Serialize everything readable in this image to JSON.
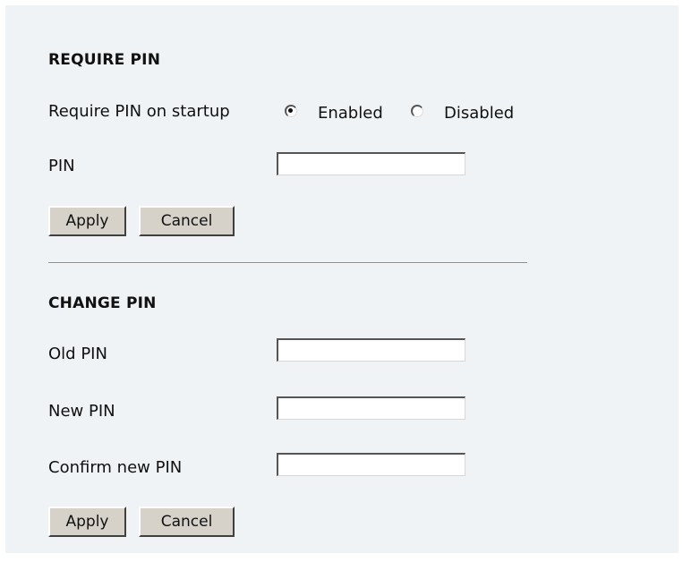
{
  "require_pin": {
    "heading": "REQUIRE PIN",
    "startup_label": "Require PIN on startup",
    "options": [
      {
        "label": "Enabled",
        "selected": true
      },
      {
        "label": "Disabled",
        "selected": false
      }
    ],
    "pin_label": "PIN",
    "pin_value": "",
    "apply_label": "Apply",
    "cancel_label": "Cancel"
  },
  "change_pin": {
    "heading": "CHANGE PIN",
    "old_pin_label": "Old PIN",
    "old_pin_value": "",
    "new_pin_label": "New PIN",
    "new_pin_value": "",
    "confirm_pin_label": "Confirm new PIN",
    "confirm_pin_value": "",
    "apply_label": "Apply",
    "cancel_label": "Cancel"
  },
  "colors": {
    "panel_background": "#eff3f6",
    "button_face": "#d6d2c9"
  }
}
